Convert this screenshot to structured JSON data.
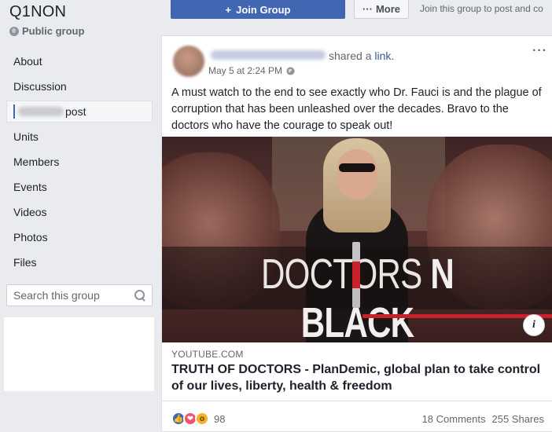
{
  "group": {
    "name": "Q1NON",
    "privacy": "Public group"
  },
  "sidebar": {
    "items": [
      {
        "label": "About"
      },
      {
        "label": "Discussion"
      },
      {
        "label": "post"
      },
      {
        "label": "Units"
      },
      {
        "label": "Members"
      },
      {
        "label": "Events"
      },
      {
        "label": "Videos"
      },
      {
        "label": "Photos"
      },
      {
        "label": "Files"
      }
    ],
    "search_placeholder": "Search this group"
  },
  "actions": {
    "join_label": "Join Group",
    "join_icon": "+",
    "more_label": "More",
    "more_icon": "···",
    "hint": "Join this group to post and co"
  },
  "post": {
    "shared_prefix": "shared a",
    "shared_link": "link.",
    "timestamp": "May 5 at 2:24 PM",
    "options_icon": "···",
    "text": "A must watch to the end to see exactly who Dr. Fauci is and the plague of corruption that has been unleashed over the decades. Bravo to the doctors who have the courage to speak out!",
    "preview": {
      "title_regular": "DOCTORS ",
      "title_bold": "N BLACK",
      "info_icon": "i",
      "source": "YOUTUBE.COM",
      "link_title": "TRUTH OF DOCTORS - PlanDemic, global plan to take control of our lives, liberty, health & freedom"
    },
    "reactions": {
      "types": [
        "like",
        "love",
        "wow"
      ],
      "count": "98",
      "comments": "18 Comments",
      "shares": "255 Shares"
    }
  },
  "colors": {
    "brand": "#4267b2",
    "link": "#385898",
    "accent_red": "#c9202a"
  }
}
